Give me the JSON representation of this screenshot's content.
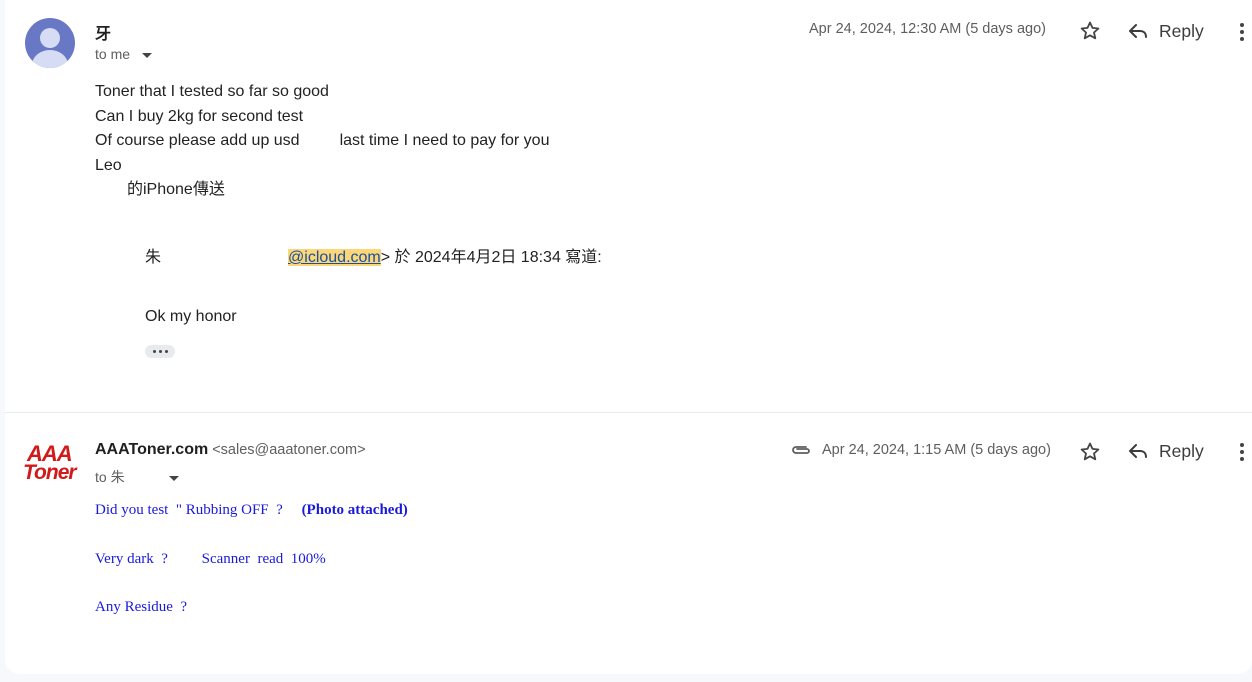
{
  "messages": [
    {
      "sender": "牙",
      "recipient": "to me",
      "date": "Apr 24, 2024, 12:30 AM (5 days ago)",
      "reply_label": "Reply",
      "body_lines": [
        "Toner that I tested so far so good",
        "Can I buy 2kg for second test",
        "Of course please add up usd         last time I need to pay for you",
        "Leo",
        "的iPhone傳送"
      ],
      "quote": {
        "name": "朱",
        "email_fragment": "@icloud.com",
        "suffix": "> 於 2024年4月2日 18:34 寫道:",
        "body": "Ok my honor"
      }
    },
    {
      "sender": "AAAToner.com",
      "sender_email": "<sales@aaatoner.com>",
      "recipient": "to 朱",
      "date": "Apr 24, 2024, 1:15 AM (5 days ago)",
      "reply_label": "Reply",
      "logo": {
        "line1": "AAA",
        "line2": "Toner"
      },
      "body": {
        "line1": "Did you test  \" Rubbing OFF  ?     ",
        "line1_bold": "(Photo attached)",
        "line2": "Very dark  ?         Scanner  read  100%",
        "line3": "Any Residue  ?"
      }
    }
  ],
  "colors": {
    "avatar": "#6878c4",
    "highlight": "#fbd77a",
    "blue_text": "#1a1add",
    "logo_red": "#d21a1a"
  },
  "icons": [
    "person-icon",
    "chevron-down-icon",
    "star-icon",
    "reply-icon",
    "more-vert-icon",
    "attachment-icon",
    "ellipsis-icon"
  ]
}
